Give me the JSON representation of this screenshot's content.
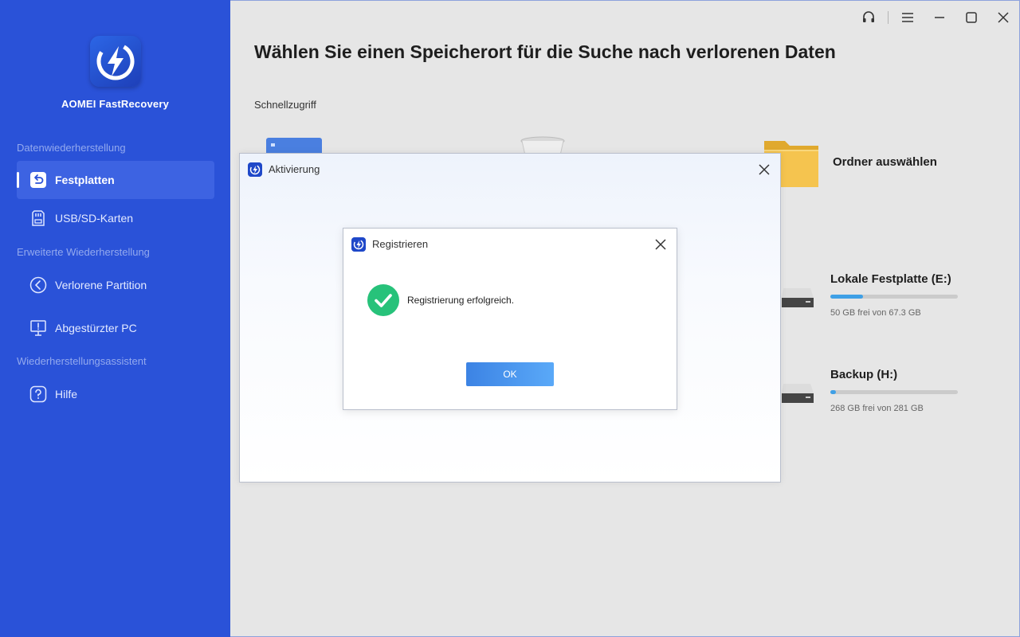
{
  "sidebar": {
    "app_name": "AOMEI FastRecovery",
    "section_recovery": "Datenwiederherstellung",
    "section_advanced": "Erweiterte Wiederherstellung",
    "section_assistant": "Wiederherstellungsassistent",
    "items": [
      {
        "label": "Festplatten",
        "icon": "disk-restore-icon",
        "active": true
      },
      {
        "label": "USB/SD-Karten",
        "icon": "sd-card-icon"
      },
      {
        "label": "Verlorene Partition",
        "icon": "partition-icon"
      },
      {
        "label": "Abgestürzter PC",
        "icon": "crashed-pc-icon"
      },
      {
        "label": "Hilfe",
        "icon": "help-icon"
      }
    ]
  },
  "main": {
    "title": "Wählen Sie einen Speicherort für die Suche nach verlorenen Daten",
    "quick_access_label": "Schnellzugriff",
    "folder_select_label": "Ordner auswählen",
    "drives": [
      {
        "name": "Lokale Festplatte (E:)",
        "size": "50 GB frei von 67.3 GB",
        "used_fraction": 0.257
      },
      {
        "name": "Backup (H:)",
        "size": "268 GB frei von 281 GB",
        "used_fraction": 0.046
      }
    ]
  },
  "activation_dialog": {
    "title": "Aktivierung"
  },
  "register_dialog": {
    "title": "Registrieren",
    "message": "Registrierung erfolgreich.",
    "ok_label": "OK"
  },
  "colors": {
    "sidebar": "#2a52d8",
    "accent": "#3c83e4",
    "success": "#27c27a"
  }
}
